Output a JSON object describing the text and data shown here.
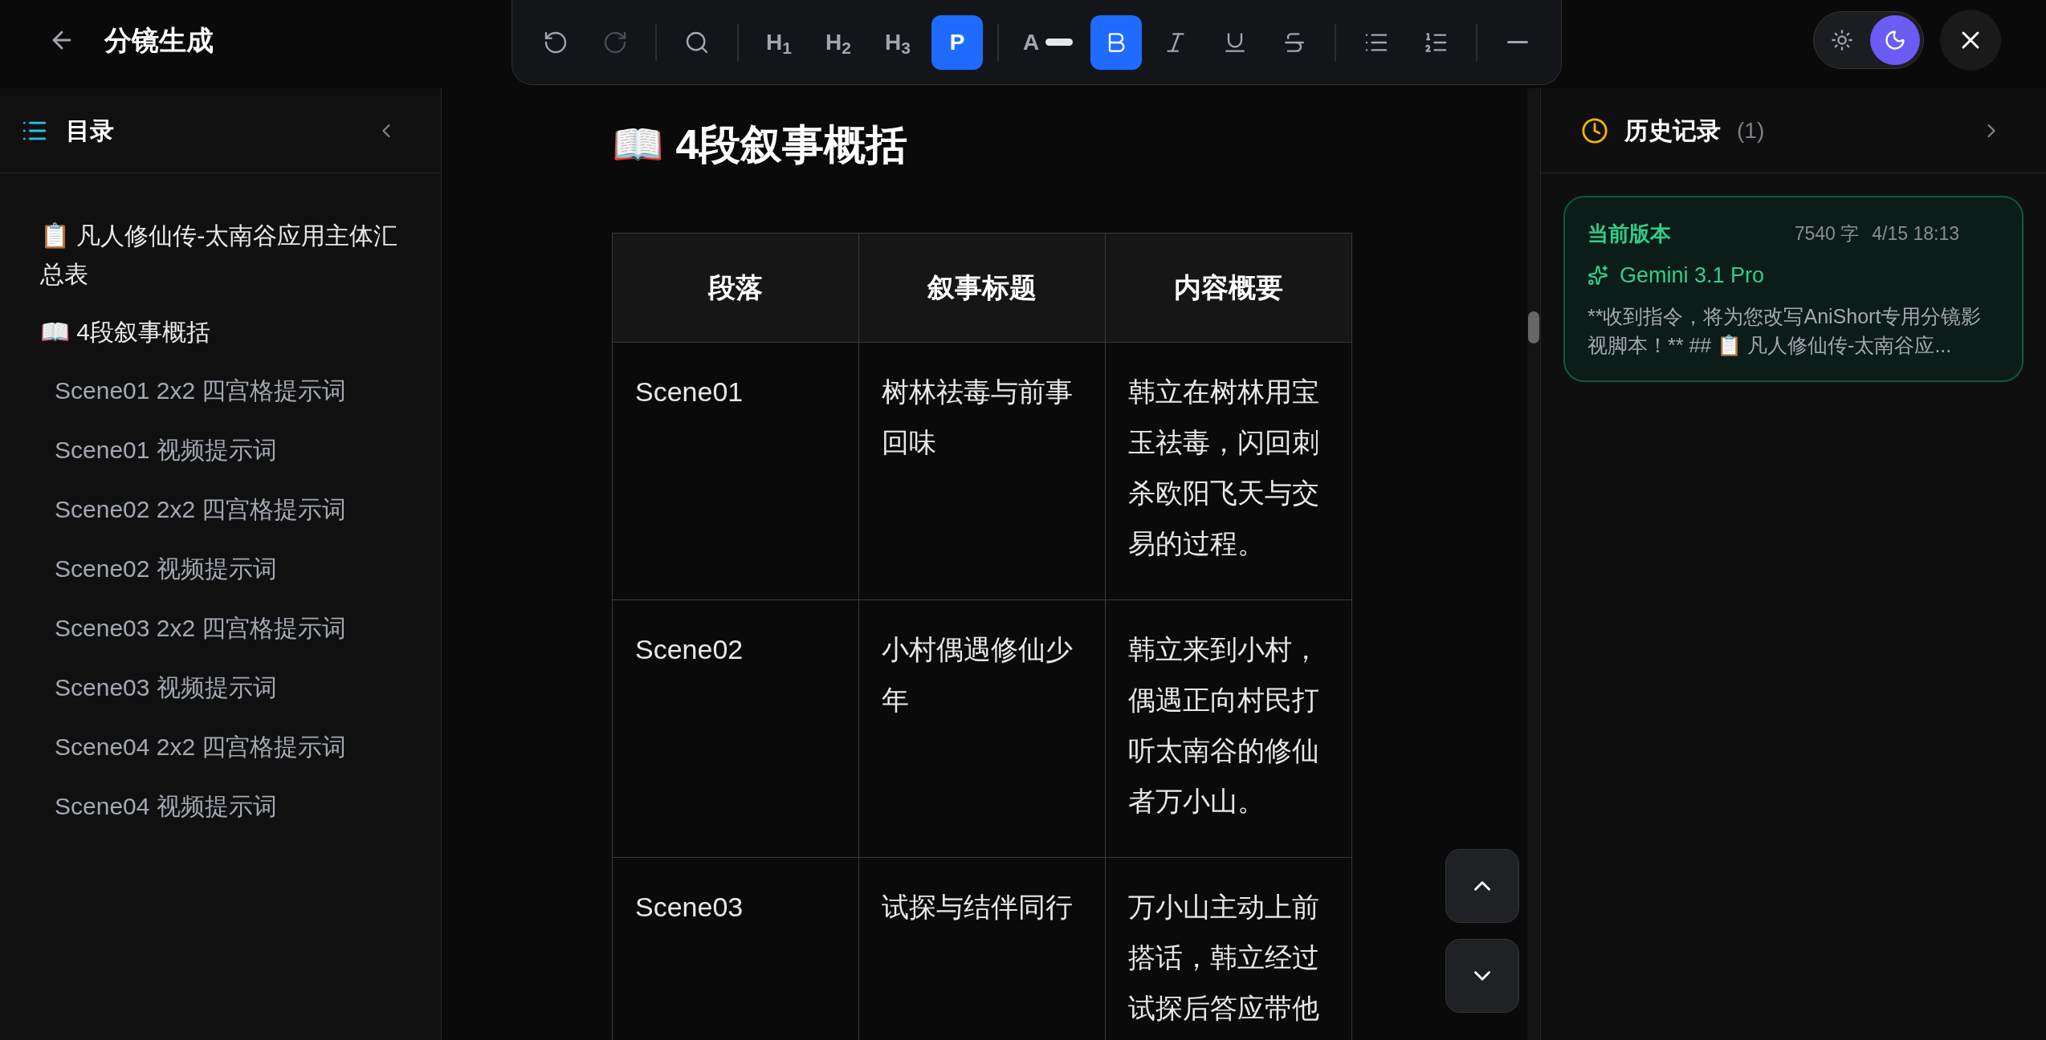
{
  "header": {
    "title": "分镜生成"
  },
  "toolbar": {
    "groups": [
      [
        {
          "kind": "undo",
          "disabled": false
        },
        {
          "kind": "redo",
          "disabled": true
        }
      ],
      [
        {
          "kind": "search"
        }
      ],
      [
        {
          "kind": "text",
          "label": "H$_{1}$",
          "selected": false
        },
        {
          "kind": "text",
          "label": "H$_{2}$",
          "selected": false
        },
        {
          "kind": "text",
          "label": "H$_{3}$",
          "selected": false
        },
        {
          "kind": "text",
          "label": "P",
          "selected": true
        }
      ],
      [
        {
          "kind": "font_color",
          "label": "A"
        },
        {
          "kind": "bold",
          "selected": true
        },
        {
          "kind": "italic",
          "selected": false
        },
        {
          "kind": "underline",
          "selected": false
        },
        {
          "kind": "strikethrough",
          "selected": false
        }
      ],
      [
        {
          "kind": "bullet_list"
        },
        {
          "kind": "ordered_list"
        }
      ],
      [
        {
          "kind": "rule"
        }
      ]
    ]
  },
  "theme_toggle": [
    {
      "kind": "light",
      "selected": false
    },
    {
      "kind": "dark",
      "selected": true
    }
  ],
  "sidebar": {
    "title": "目录",
    "items": [
      {
        "label": "📋 凡人修仙传-太南谷应用主体汇总表"
      },
      {
        "label": "📖 4段叙事概括",
        "children": [
          {
            "label": "Scene01 2x2 四宫格提示词"
          },
          {
            "label": "Scene01 视频提示词"
          },
          {
            "label": "Scene02 2x2 四宫格提示词"
          },
          {
            "label": "Scene02 视频提示词"
          },
          {
            "label": "Scene03 2x2 四宫格提示词"
          },
          {
            "label": "Scene03 视频提示词"
          },
          {
            "label": "Scene04 2x2 四宫格提示词"
          },
          {
            "label": "Scene04 视频提示词"
          }
        ]
      }
    ]
  },
  "document": {
    "heading": "📖 4段叙事概括",
    "table": {
      "columns": [
        "段落",
        "叙事标题",
        "内容概要"
      ],
      "rows": [
        [
          "Scene01",
          "树林祛毒与前事回味",
          "韩立在树林用宝玉祛毒，闪回刺杀欧阳飞天与交易的过程。"
        ],
        [
          "Scene02",
          "小村偶遇修仙少年",
          "韩立来到小村，偶遇正向村民打听太南谷的修仙者万小山。"
        ],
        [
          "Scene03",
          "试探与结伴同行",
          "万小山主动上前搭话，韩立经过试探后答应带他"
        ]
      ]
    }
  },
  "history": {
    "title": "历史记录",
    "count": "(1)",
    "entries": [
      {
        "label": "当前版本",
        "words": "7540 字",
        "time": "4/15 18:13",
        "model": "Gemini 3.1 Pro",
        "preview": "**收到指令，将为您改写AniShort专用分镜影视脚本！** ## 📋 凡人修仙传-太南谷应..."
      }
    ]
  }
}
